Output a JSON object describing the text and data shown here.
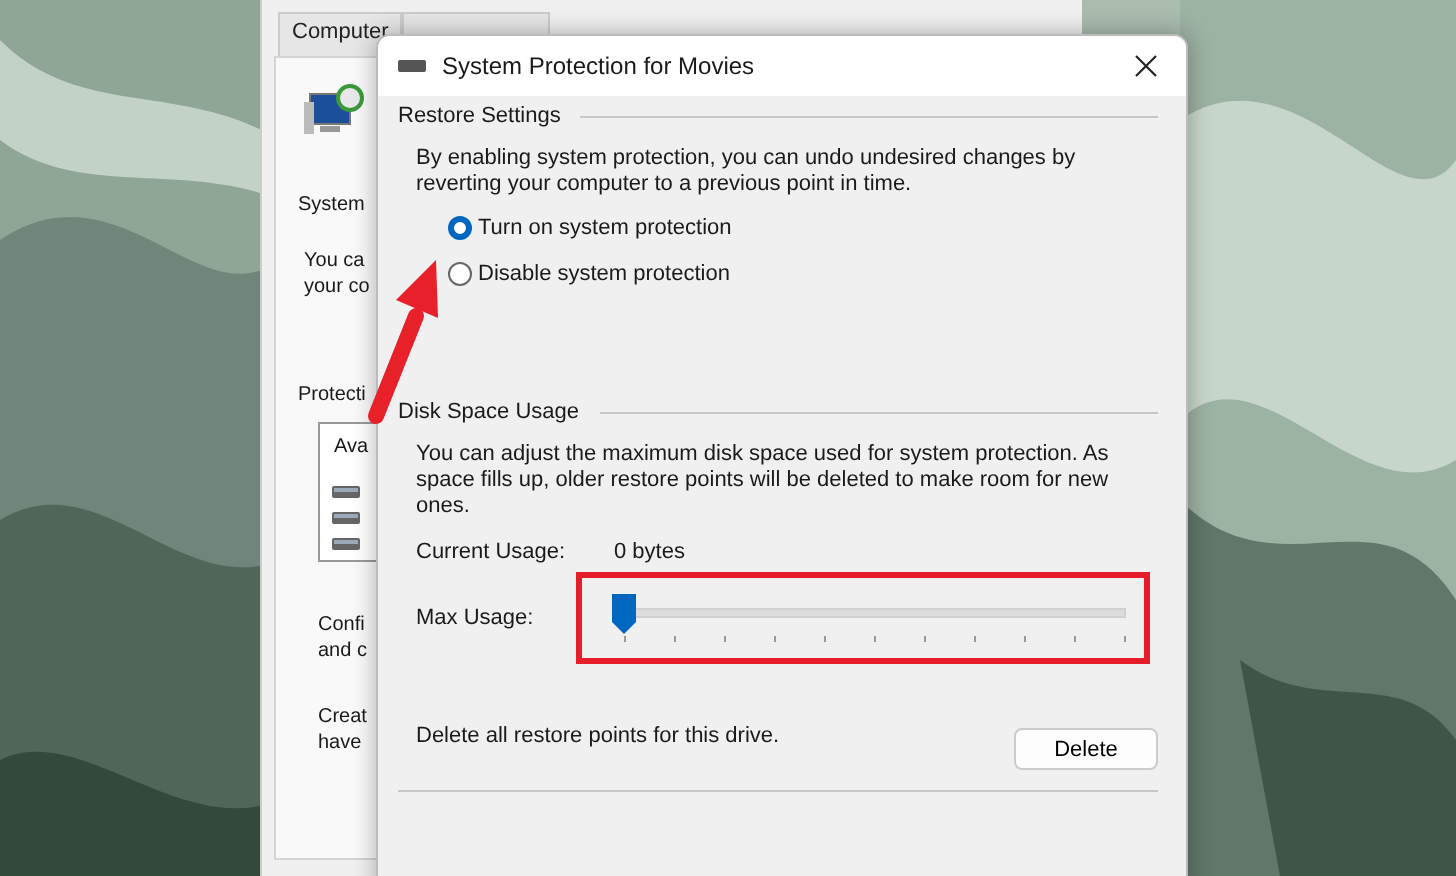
{
  "back_window": {
    "tabs": [
      {
        "label": "Computer",
        "selected": false
      }
    ],
    "texts": [
      "System",
      "You ca",
      "your co",
      "Protecti",
      "Ava",
      "Confi",
      "and c",
      "Creat",
      "have"
    ]
  },
  "dialog": {
    "title": "System Protection for Movies",
    "restore_settings": {
      "heading": "Restore Settings",
      "description": "By enabling system protection, you can undo undesired changes by reverting your computer to a previous point in time.",
      "options": [
        {
          "label": "Turn on system protection",
          "selected": true
        },
        {
          "label": "Disable system protection",
          "selected": false
        }
      ]
    },
    "disk_space": {
      "heading": "Disk Space Usage",
      "description": "You can adjust the maximum disk space used for system protection. As space fills up, older restore points will be deleted to make room for new ones.",
      "current_usage_label": "Current Usage:",
      "current_usage_value": "0 bytes",
      "max_usage_label": "Max Usage:",
      "max_usage": {
        "level": 0
      }
    },
    "delete_text": "Delete all restore points for this drive.",
    "delete_button": "Delete"
  }
}
